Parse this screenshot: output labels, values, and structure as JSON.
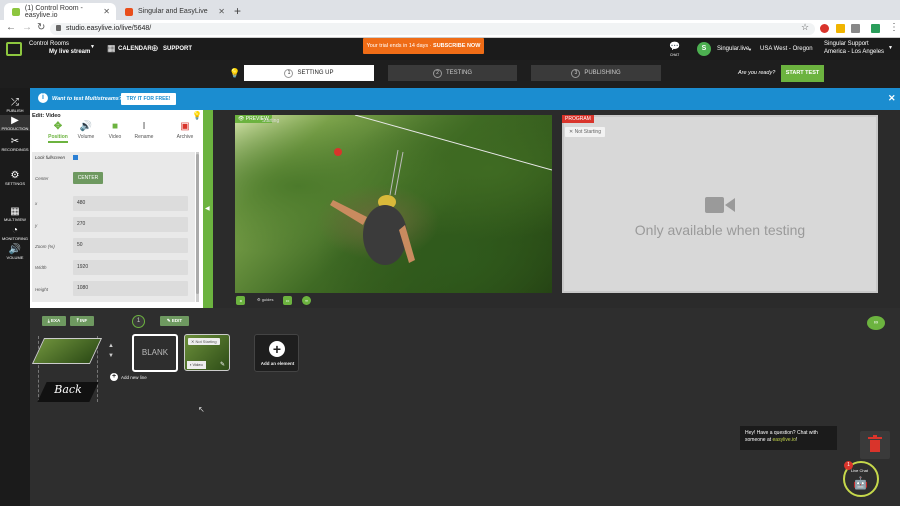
{
  "browser": {
    "tabs": [
      {
        "label": "(1) Control Room - easylive.io",
        "active": true
      },
      {
        "label": "Singular and EasyLive",
        "active": false
      }
    ],
    "url": "studio.easylive.io/live/5648/"
  },
  "header": {
    "control_rooms": "Control Rooms",
    "my_live_stream": "My live stream",
    "calendar": "CALENDAR",
    "support": "SUPPORT",
    "trial_text": "Your trial ends in 14 days · ",
    "subscribe": "SUBSCRIBE NOW",
    "chat": "CHAT",
    "avatar_letter": "S",
    "user": "Singular.live",
    "region": "USA West - Oregon",
    "support_name": "Singular Support",
    "timezone": "America - Los Angeles"
  },
  "steps": [
    {
      "num": "1",
      "label": "SETTING UP",
      "active": true
    },
    {
      "num": "2",
      "label": "TESTING",
      "active": false
    },
    {
      "num": "3",
      "label": "PUBLISHING",
      "active": false
    }
  ],
  "ready_text": "Are you ready?",
  "start_test": "START TEST",
  "banner": {
    "text": "Want to test Multistreams?",
    "button": "TRY IT FOR FREE!"
  },
  "sidebar": [
    {
      "icon": "shuffle-icon",
      "glyph": "⤮",
      "label": "PUBLISH"
    },
    {
      "icon": "camera-icon",
      "glyph": "▶",
      "label": "PRODUCTION"
    },
    {
      "icon": "scissors-icon",
      "glyph": "✂",
      "label": "RECORDINGS"
    },
    {
      "icon": "settings-icon",
      "glyph": "⚙",
      "label": "SETTINGS"
    },
    {
      "icon": "grid-icon",
      "glyph": "▦",
      "label": "MULTIVIEW"
    },
    {
      "icon": "gauge-icon",
      "glyph": "◔",
      "label": "MONITORING"
    },
    {
      "icon": "volume-icon",
      "glyph": "🔊",
      "label": "VOLUME"
    }
  ],
  "edit": {
    "title": "Edit: Video",
    "tools": [
      {
        "icon": "position-icon",
        "glyph": "✥",
        "label": "Position"
      },
      {
        "icon": "volume-icon",
        "glyph": "🔊",
        "label": "Volume"
      },
      {
        "icon": "video-icon",
        "glyph": "■",
        "label": "Video"
      },
      {
        "icon": "rename-icon",
        "glyph": "I",
        "label": "Rename"
      },
      {
        "icon": "archive-icon",
        "glyph": "▣",
        "label": "Archive"
      }
    ],
    "lock_fullscreen": "Lock fullscreen",
    "center_label": "Center",
    "center_button": "CENTER",
    "fields": [
      {
        "label": "x",
        "value": "480"
      },
      {
        "label": "y",
        "value": "270"
      },
      {
        "label": "Zoom (%)",
        "value": "50"
      },
      {
        "label": "Width",
        "value": "1920"
      },
      {
        "label": "Height",
        "value": "1080"
      }
    ]
  },
  "preview": {
    "tag": "PREVIEW",
    "status": "Starting",
    "controls": [
      "guides"
    ]
  },
  "program": {
    "tag": "PROGRAM",
    "status": "Not Starting",
    "message": "Only available when testing"
  },
  "layers": {
    "exa": "EXA",
    "info": "INF",
    "edit": "EDIT",
    "index": "1",
    "back": "Back",
    "add_new_line": "Add new line",
    "blank": "BLANK",
    "video_status": "Not Starting",
    "video_label": "Video",
    "add_element": "Add an element"
  },
  "chat": {
    "line1": "Hey! Have a question? Chat with",
    "line2": "someone at ",
    "link": "easylive.io",
    "line3": "!",
    "live_chat": "Live Chat",
    "badge": "1"
  },
  "colors": {
    "accent": "#6cb33f",
    "banner": "#1b8dd0",
    "trial": "#ef6c16",
    "program": "#d9342b"
  }
}
